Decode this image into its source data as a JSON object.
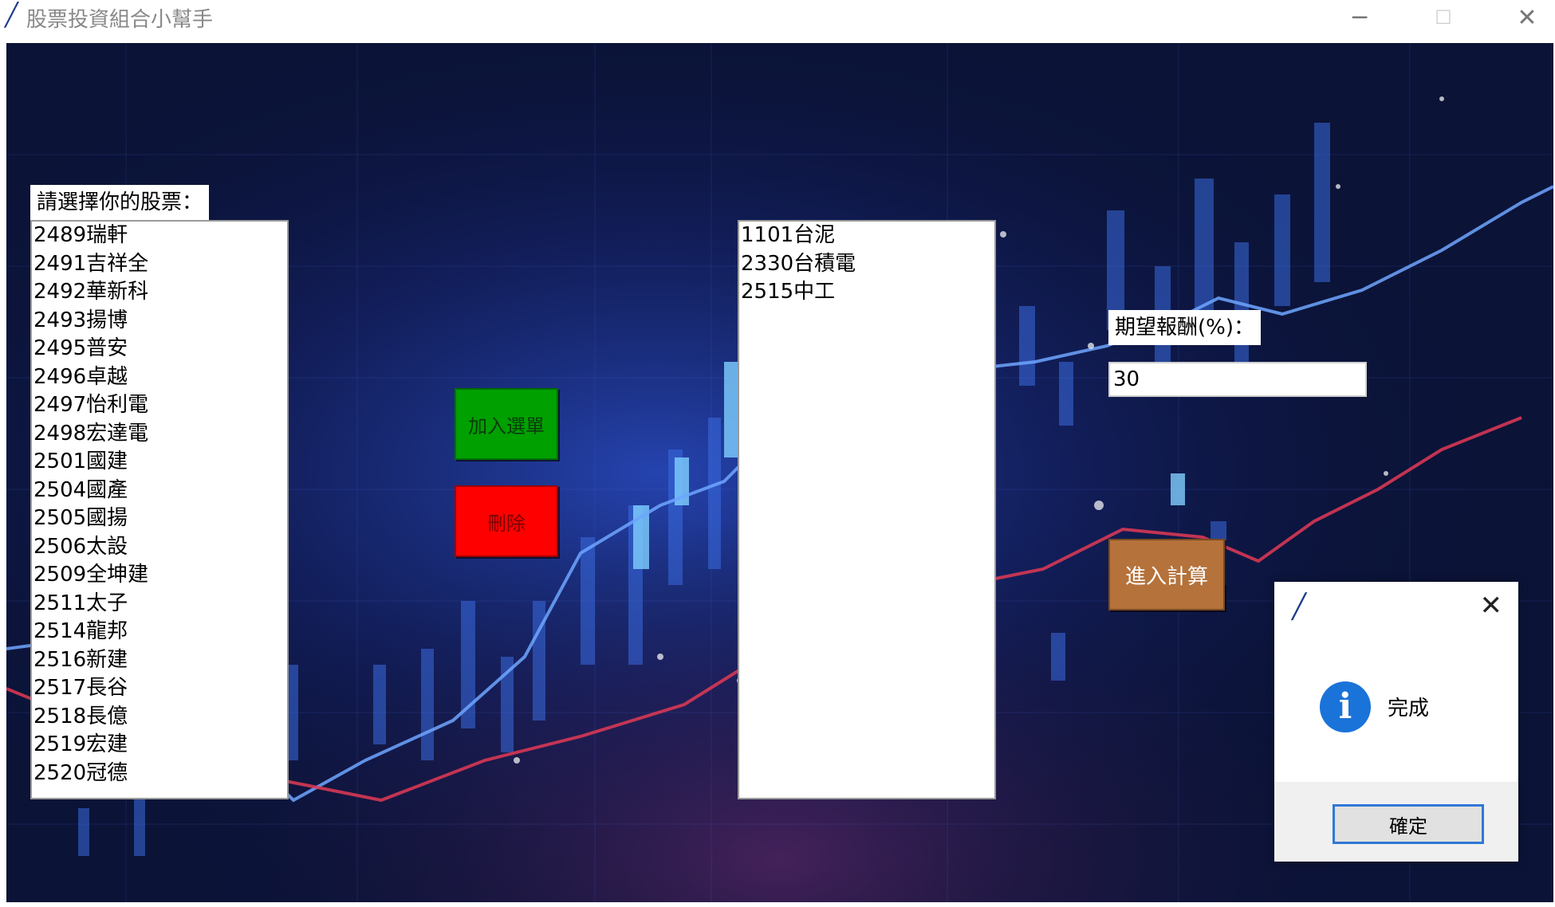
{
  "window": {
    "title": "股票投資組合小幫手",
    "minimize_glyph": "─",
    "maximize_glyph": "☐",
    "close_glyph": "✕"
  },
  "stock_list": {
    "label": "請選擇你的股票：",
    "items": [
      "2489瑞軒",
      "2491吉祥全",
      "2492華新科",
      "2493揚博",
      "2495普安",
      "2496卓越",
      "2497怡利電",
      "2498宏達電",
      "2501國建",
      "2504國產",
      "2505國揚",
      "2506太設",
      "2509全坤建",
      "2511太子",
      "2514龍邦",
      "2516新建",
      "2517長谷",
      "2518長億",
      "2519宏建",
      "2520冠德"
    ]
  },
  "buttons": {
    "add_label": "加入選單",
    "delete_label": "刪除",
    "calculate_label": "進入計算"
  },
  "selected_list": {
    "items": [
      "1101台泥",
      "2330台積電",
      "2515中工"
    ]
  },
  "expected_return": {
    "label": "期望報酬(%)：",
    "value": "30"
  },
  "dialog": {
    "message": "完成",
    "ok_label": "確定",
    "close_glyph": "✕",
    "info_glyph": "i"
  },
  "colors": {
    "add_button": "#00a000",
    "delete_button": "#ff0000",
    "calculate_button": "#b5723b",
    "background": "#0d1640"
  }
}
